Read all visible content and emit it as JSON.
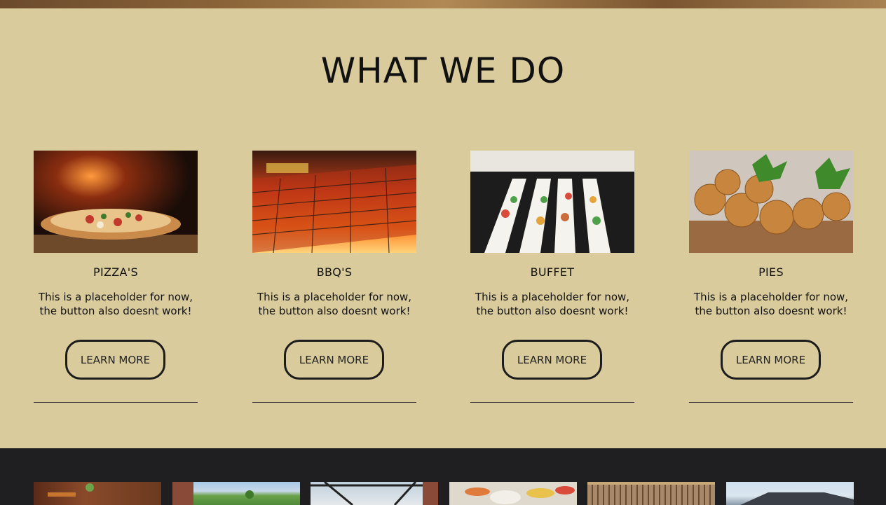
{
  "section": {
    "title": "WHAT WE DO"
  },
  "cards": [
    {
      "title": "PIZZA'S",
      "description": "This is a placeholder for now, the button also doesnt work!",
      "button_label": "LEARN MORE"
    },
    {
      "title": "BBQ'S",
      "description": "This is a placeholder for now, the button also doesnt work!",
      "button_label": "LEARN MORE"
    },
    {
      "title": "BUFFET",
      "description": "This is a placeholder for now, the button also doesnt work!",
      "button_label": "LEARN MORE"
    },
    {
      "title": "PIES",
      "description": "This is a placeholder for now, the button also doesnt work!",
      "button_label": "LEARN MORE"
    }
  ],
  "colors": {
    "page_background": "#d9cb9c",
    "footer_background": "#1f1e21",
    "text": "#111111",
    "button_border": "#1c1c1c"
  }
}
